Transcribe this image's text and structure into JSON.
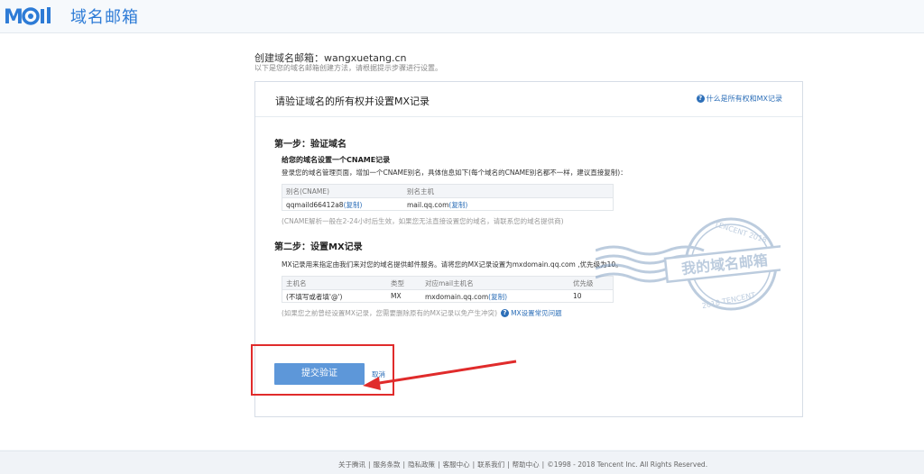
{
  "header": {
    "logo_mark": "MOil",
    "logo_text": "域名邮箱"
  },
  "page": {
    "title": "创建域名邮箱：wangxuetang.cn",
    "subtitle": "以下是您的域名邮箱创建方法，请根据提示步骤进行设置。"
  },
  "panel": {
    "title": "请验证域名的所有权并设置MX记录",
    "help_link": "什么是所有权和MX记录"
  },
  "step1": {
    "title": "第一步：验证域名",
    "subtitle": "给您的域名设置一个CNAME记录",
    "instruction": "登录您的域名管理页面，增加一个CNAME别名，具体信息如下(每个域名的CNAME别名都不一样，建议直接复制)：",
    "table": {
      "headers": [
        "别名(CNAME)",
        "别名主机"
      ],
      "rows": [
        {
          "alias": "qqmaild66412a8",
          "alias_copy": "(复制)",
          "host": "mail.qq.com",
          "host_copy": "(复制)"
        }
      ]
    },
    "note": "(CNAME解析一般在2-24小时后生效，如果您无法直接设置您的域名，请联系您的域名提供商)"
  },
  "step2": {
    "title": "第二步：设置MX记录",
    "instruction": "MX记录用来指定由我们来对您的域名提供邮件服务。请将您的MX记录设置为mxdomain.qq.com ,优先级为10。",
    "table": {
      "headers": [
        "主机名",
        "类型",
        "对应mail主机名",
        "优先级"
      ],
      "rows": [
        {
          "host": "(不填写或者填'@')",
          "type": "MX",
          "mail_host": "mxdomain.qq.com",
          "copy": "(复制)",
          "priority": "10"
        }
      ]
    },
    "note": "(如果您之前曾经设置MX记录，您需要删除原有的MX记录以免产生冲突)",
    "faq_link": "MX设置常见问题"
  },
  "actions": {
    "submit": "提交验证",
    "cancel": "取消"
  },
  "stamp": {
    "text": "我的域名邮箱",
    "top_text": "TENCENT 2018",
    "bottom_text": "2018 TENCENT"
  },
  "footer": {
    "links": [
      "关于腾讯",
      "服务条款",
      "隐私政策",
      "客服中心",
      "联系我们",
      "帮助中心"
    ],
    "copyright": "©1998 - 2018 Tencent Inc. All Rights Reserved."
  },
  "colors": {
    "accent": "#2d7bd6",
    "button": "#5d97d9",
    "highlight": "#e02b2b"
  }
}
